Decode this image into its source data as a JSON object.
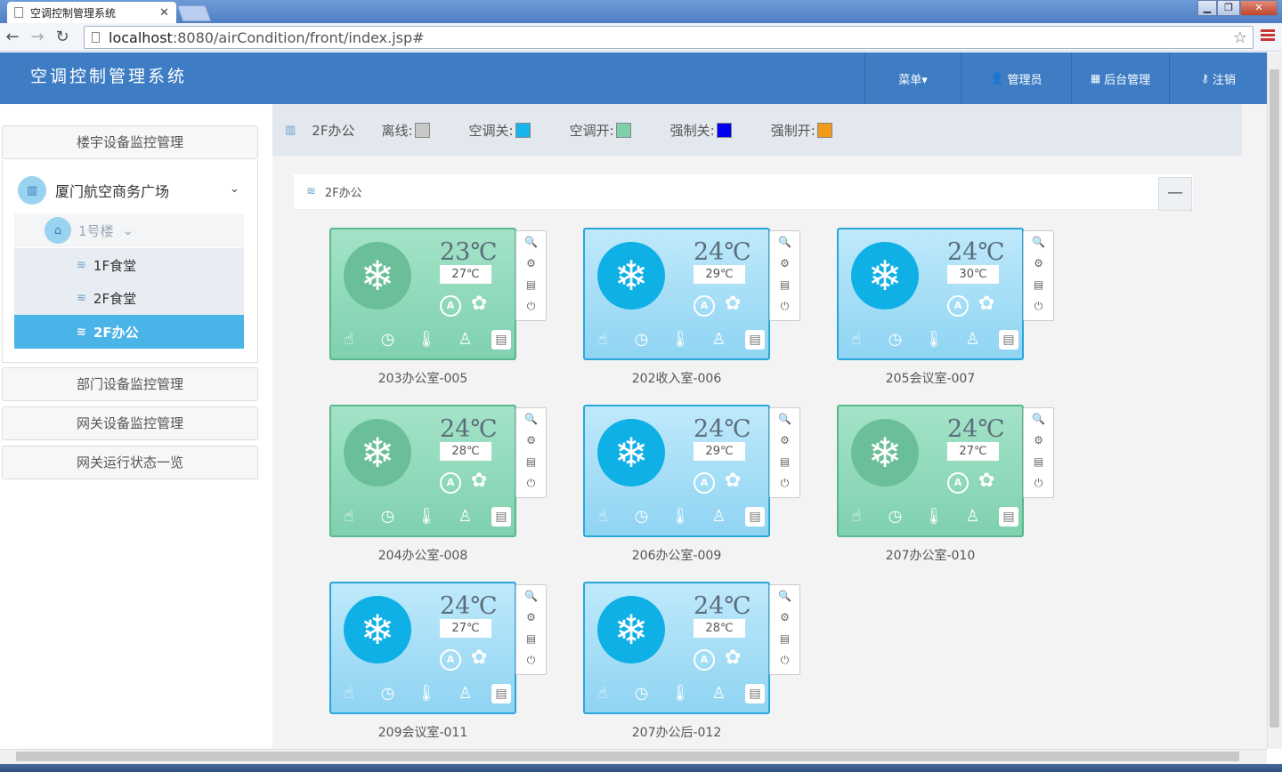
{
  "browser": {
    "tab_title": "空调控制管理系统",
    "url_host": "localhost",
    "url_rest": ":8080/airCondition/front/index.jsp#"
  },
  "app": {
    "title": "空调控制管理系统",
    "nav": [
      {
        "label": "菜单▾",
        "icon": "menu"
      },
      {
        "label": "管理员",
        "icon": "user-icon"
      },
      {
        "label": "后台管理",
        "icon": "grid-icon"
      },
      {
        "label": "注销",
        "icon": "key-icon"
      }
    ]
  },
  "sidebar": {
    "sections": [
      "楼宇设备监控管理",
      "部门设备监控管理",
      "网关设备监控管理",
      "网关运行状态一览"
    ],
    "tree_root": "厦门航空商务广场",
    "building": "1号楼",
    "floors": [
      "1F食堂",
      "2F食堂",
      "2F办公"
    ],
    "active_floor": "2F办公"
  },
  "legend": {
    "current": "2F办公",
    "items": [
      {
        "label": "离线:",
        "color": "#c8c8c8"
      },
      {
        "label": "空调关:",
        "color": "#18b4ec"
      },
      {
        "label": "空调开:",
        "color": "#7fcfa8"
      },
      {
        "label": "强制关:",
        "color": "#0000ee"
      },
      {
        "label": "强制开:",
        "color": "#f29a1c"
      }
    ]
  },
  "panel": {
    "title": "2F办公",
    "collapse": "—"
  },
  "devices": [
    {
      "name": "203办公室-005",
      "temp": "23℃",
      "set": "27℃",
      "state": "green"
    },
    {
      "name": "202收入室-006",
      "temp": "24℃",
      "set": "29℃",
      "state": "blue"
    },
    {
      "name": "205会议室-007",
      "temp": "24℃",
      "set": "30℃",
      "state": "blue"
    },
    {
      "name": "204办公室-008",
      "temp": "24℃",
      "set": "28℃",
      "state": "green"
    },
    {
      "name": "206办公室-009",
      "temp": "24℃",
      "set": "29℃",
      "state": "blue"
    },
    {
      "name": "207办公室-010",
      "temp": "24℃",
      "set": "27℃",
      "state": "green"
    },
    {
      "name": "209会议室-011",
      "temp": "24℃",
      "set": "27℃",
      "state": "blue"
    },
    {
      "name": "207办公后-012",
      "temp": "24℃",
      "set": "28℃",
      "state": "blue"
    }
  ]
}
